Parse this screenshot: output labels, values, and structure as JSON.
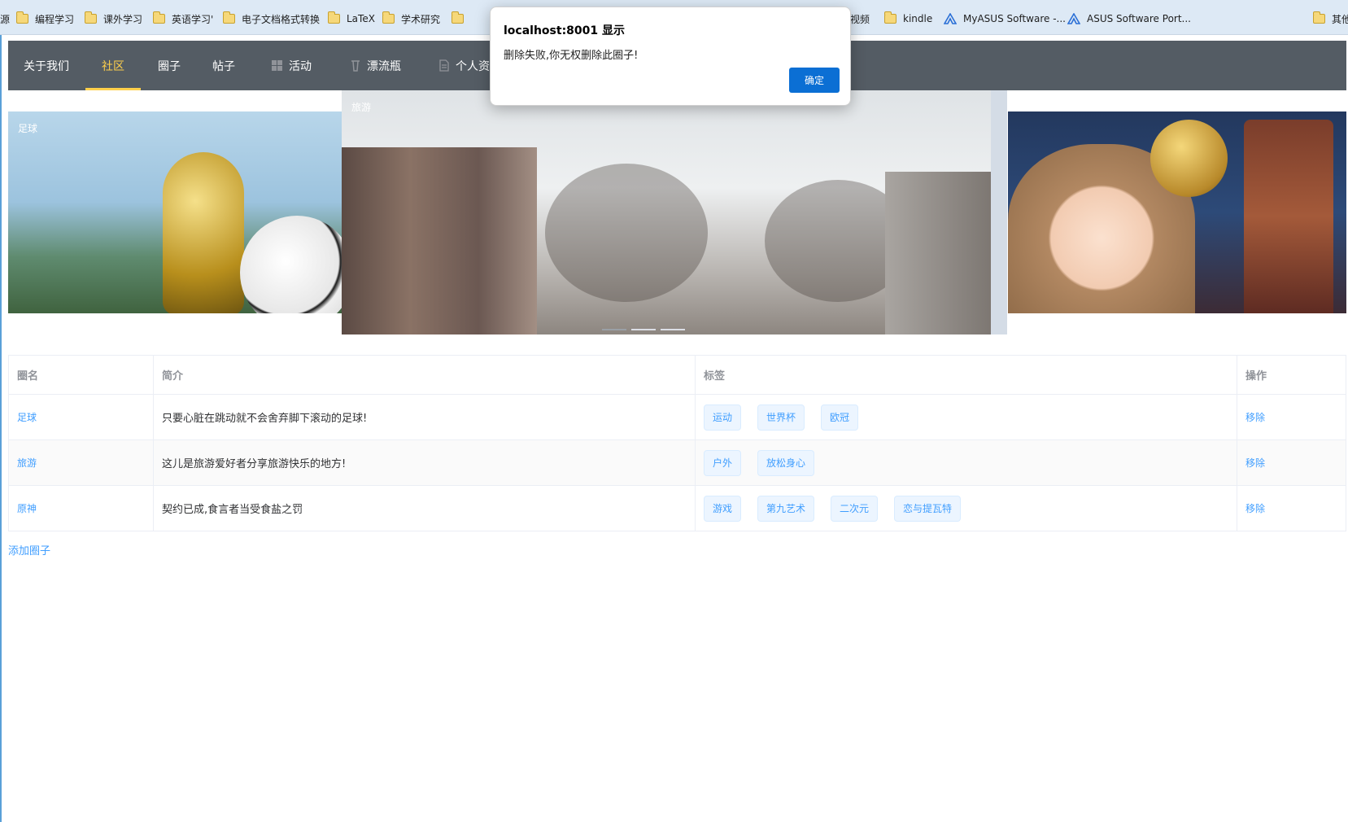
{
  "bookmarks": [
    {
      "label": "源",
      "icon": "none"
    },
    {
      "label": "编程学习",
      "icon": "folder-icon"
    },
    {
      "label": "课外学习",
      "icon": "folder-icon"
    },
    {
      "label": "英语学习'",
      "icon": "folder-icon"
    },
    {
      "label": "电子文档格式转换",
      "icon": "folder-icon"
    },
    {
      "label": "LaTeX",
      "icon": "folder-icon"
    },
    {
      "label": "学术研究",
      "icon": "folder-icon"
    },
    {
      "label": "",
      "icon": "folder-icon"
    },
    {
      "label": "视频",
      "icon": "none"
    },
    {
      "label": "kindle",
      "icon": "folder-icon"
    },
    {
      "label": "MyASUS Software -...",
      "icon": "asus-icon"
    },
    {
      "label": "ASUS Software Port...",
      "icon": "asus-icon"
    },
    {
      "label": "其他",
      "icon": "folder-icon"
    }
  ],
  "nav": {
    "items": [
      "关于我们",
      "社区",
      "圈子",
      "帖子",
      "活动",
      "漂流瓶",
      "个人资"
    ],
    "active_index": 1,
    "active_color": "#ffd04b",
    "background": "#545c64"
  },
  "carousel": {
    "cards": [
      "足球",
      "旅游",
      ""
    ],
    "active_index": 1,
    "indicator_count": 3
  },
  "table": {
    "headers": [
      "圈名",
      "简介",
      "标签",
      "操作"
    ],
    "rows": [
      {
        "name": "足球",
        "intro": "只要心脏在跳动就不会舍弃脚下滚动的足球!",
        "tags": [
          "运动",
          "世界杯",
          "欧冠"
        ],
        "action": "移除"
      },
      {
        "name": "旅游",
        "intro": "这儿是旅游爱好者分享旅游快乐的地方!",
        "tags": [
          "户外",
          "放松身心"
        ],
        "action": "移除"
      },
      {
        "name": "原神",
        "intro": "契约已成,食言者当受食盐之罚",
        "tags": [
          "游戏",
          "第九艺术",
          "二次元",
          "恋与提瓦特"
        ],
        "action": "移除"
      }
    ],
    "add_label": "添加圈子"
  },
  "dialog": {
    "title": "localhost:8001 显示",
    "message": "删除失败,你无权删除此圈子!",
    "ok_label": "确定",
    "ok_color": "#0b6fd4"
  },
  "colors": {
    "link": "#409eff",
    "tag_bg": "#ecf5ff"
  }
}
